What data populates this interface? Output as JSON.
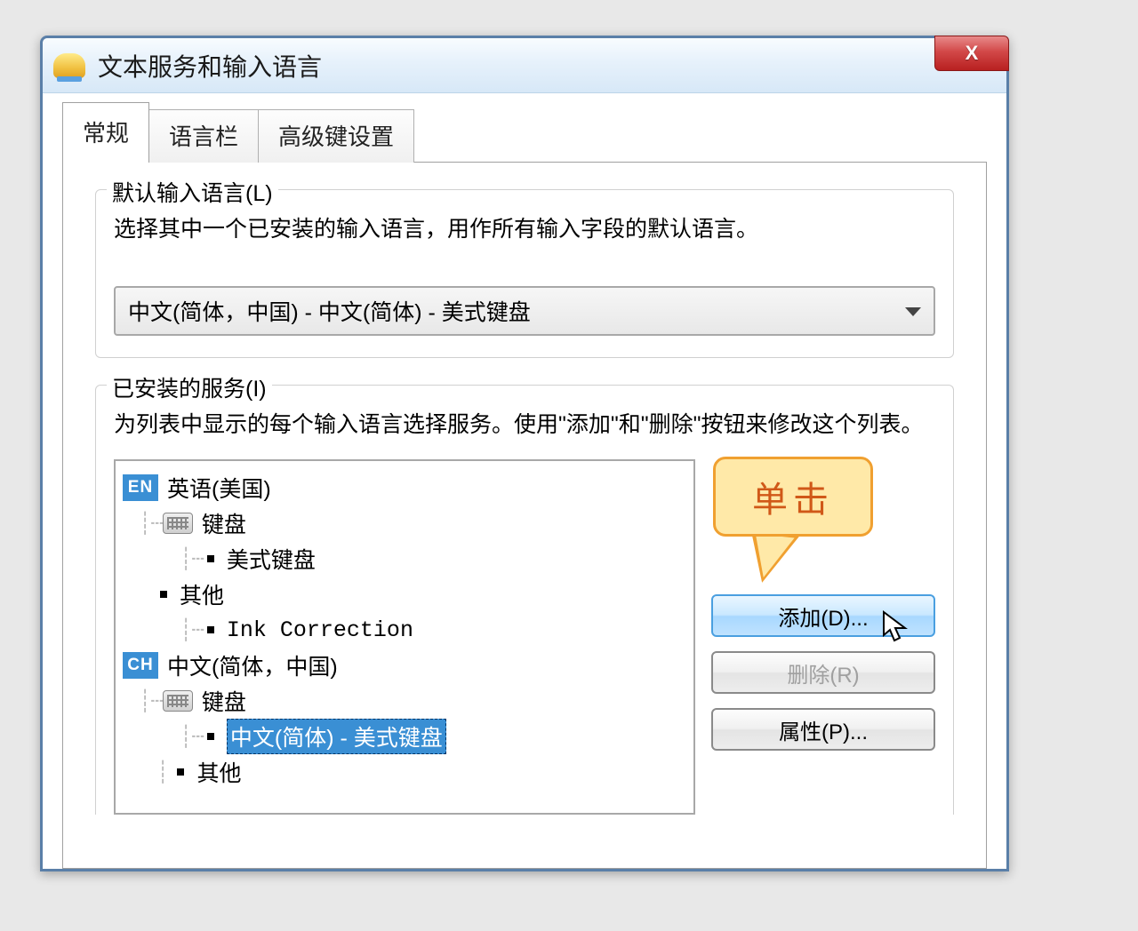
{
  "window": {
    "title": "文本服务和输入语言",
    "close_x": "X"
  },
  "tabs": [
    {
      "label": "常规",
      "active": true
    },
    {
      "label": "语言栏",
      "active": false
    },
    {
      "label": "高级键设置",
      "active": false
    }
  ],
  "default_lang": {
    "legend": "默认输入语言(L)",
    "description": "选择其中一个已安装的输入语言，用作所有输入字段的默认语言。",
    "selected": "中文(简体，中国) - 中文(简体) - 美式键盘"
  },
  "installed": {
    "legend": "已安装的服务(I)",
    "description": "为列表中显示的每个输入语言选择服务。使用\"添加\"和\"删除\"按钮来修改这个列表。",
    "tree": {
      "en_badge": "EN",
      "en_lang": "英语(美国)",
      "en_kbd_label": "键盘",
      "en_kbd_items": [
        "美式键盘"
      ],
      "en_other_label": "其他",
      "en_other_items": [
        "Ink Correction"
      ],
      "ch_badge": "CH",
      "ch_lang": "中文(简体，中国)",
      "ch_kbd_label": "键盘",
      "ch_kbd_selected": "中文(简体) - 美式键盘",
      "ch_other_label": "其他"
    },
    "buttons": {
      "add": "添加(D)...",
      "remove": "删除(R)",
      "properties": "属性(P)..."
    }
  },
  "callout": {
    "text": "单击"
  }
}
